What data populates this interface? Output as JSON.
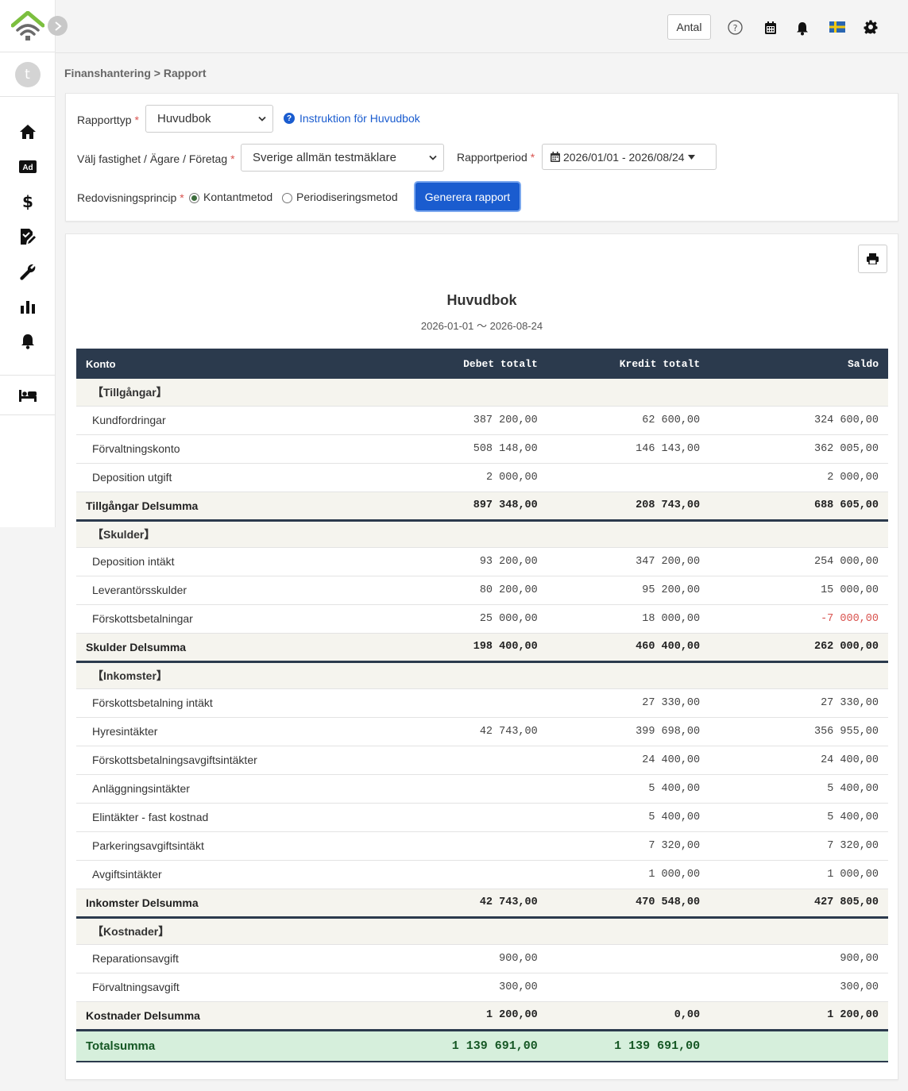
{
  "topbar": {
    "antal_label": "Antal"
  },
  "sidebar": {
    "avatar_letter": "t",
    "items": [
      {
        "icon": "home-icon"
      },
      {
        "icon": "ad-icon",
        "badge": "Ad"
      },
      {
        "icon": "dollar-icon",
        "glyph": "$"
      },
      {
        "icon": "document-edit-icon"
      },
      {
        "icon": "wrench-icon"
      },
      {
        "icon": "bar-chart-icon"
      },
      {
        "icon": "bell-icon"
      }
    ],
    "bottom_item": {
      "icon": "bed-icon"
    }
  },
  "breadcrumb": "Finanshantering > Rapport",
  "form": {
    "report_type_label": "Rapporttyp",
    "report_type_value": "Huvudbok",
    "help_link": "Instruktion för Huvudbok",
    "property_label": "Välj fastighet / Ägare / Företag",
    "property_value": "Sverige allmän testmäklare",
    "period_label": "Rapportperiod",
    "period_value": "2026/01/01 - 2026/08/24",
    "principle_label": "Redovisningsprincip",
    "radio_cash": "Kontantmetod",
    "radio_accrual": "Periodiseringsmetod",
    "selected_principle": "Kontantmetod",
    "generate_button": "Generera rapport"
  },
  "report": {
    "title": "Huvudbok",
    "subtitle": "2026-01-01 〜 2026-08-24",
    "columns": [
      "Konto",
      "Debet totalt",
      "Kredit totalt",
      "Saldo"
    ],
    "rows": [
      {
        "type": "section",
        "name": "【Tillgångar】"
      },
      {
        "type": "item",
        "name": "Kundfordringar",
        "debit": "387 200,00",
        "credit": "62 600,00",
        "balance": "324 600,00"
      },
      {
        "type": "item",
        "name": "Förvaltningskonto",
        "debit": "508 148,00",
        "credit": "146 143,00",
        "balance": "362 005,00"
      },
      {
        "type": "item",
        "name": "Deposition utgift",
        "debit": "2 000,00",
        "credit": "",
        "balance": "2 000,00"
      },
      {
        "type": "subtotal",
        "name": "Tillgångar Delsumma",
        "debit": "897 348,00",
        "credit": "208 743,00",
        "balance": "688 605,00"
      },
      {
        "type": "section",
        "name": "【Skulder】"
      },
      {
        "type": "item",
        "name": "Deposition intäkt",
        "debit": "93 200,00",
        "credit": "347 200,00",
        "balance": "254 000,00"
      },
      {
        "type": "item",
        "name": "Leverantörsskulder",
        "debit": "80 200,00",
        "credit": "95 200,00",
        "balance": "15 000,00"
      },
      {
        "type": "item",
        "name": "Förskottsbetalningar",
        "debit": "25 000,00",
        "credit": "18 000,00",
        "balance": "-7 000,00",
        "negative": true
      },
      {
        "type": "subtotal",
        "name": "Skulder Delsumma",
        "debit": "198 400,00",
        "credit": "460 400,00",
        "balance": "262 000,00"
      },
      {
        "type": "section",
        "name": "【Inkomster】"
      },
      {
        "type": "item",
        "name": "Förskottsbetalning intäkt",
        "debit": "",
        "credit": "27 330,00",
        "balance": "27 330,00"
      },
      {
        "type": "item",
        "name": "Hyresintäkter",
        "debit": "42 743,00",
        "credit": "399 698,00",
        "balance": "356 955,00"
      },
      {
        "type": "item",
        "name": "Förskottsbetalningsavgiftsintäkter",
        "debit": "",
        "credit": "24 400,00",
        "balance": "24 400,00"
      },
      {
        "type": "item",
        "name": "Anläggningsintäkter",
        "debit": "",
        "credit": "5 400,00",
        "balance": "5 400,00"
      },
      {
        "type": "item",
        "name": "Elintäkter - fast kostnad",
        "debit": "",
        "credit": "5 400,00",
        "balance": "5 400,00"
      },
      {
        "type": "item",
        "name": "Parkeringsavgiftsintäkt",
        "debit": "",
        "credit": "7 320,00",
        "balance": "7 320,00"
      },
      {
        "type": "item",
        "name": "Avgiftsintäkter",
        "debit": "",
        "credit": "1 000,00",
        "balance": "1 000,00"
      },
      {
        "type": "subtotal",
        "name": "Inkomster Delsumma",
        "debit": "42 743,00",
        "credit": "470 548,00",
        "balance": "427 805,00"
      },
      {
        "type": "section",
        "name": "【Kostnader】"
      },
      {
        "type": "item",
        "name": "Reparationsavgift",
        "debit": "900,00",
        "credit": "",
        "balance": "900,00"
      },
      {
        "type": "item",
        "name": "Förvaltningsavgift",
        "debit": "300,00",
        "credit": "",
        "balance": "300,00"
      },
      {
        "type": "subtotal",
        "name": "Kostnader Delsumma",
        "debit": "1 200,00",
        "credit": "0,00",
        "balance": "1 200,00"
      },
      {
        "type": "total",
        "name": "Totalsumma",
        "debit": "1 139 691,00",
        "credit": "1 139 691,00",
        "balance": ""
      }
    ]
  },
  "colors": {
    "header_dark": "#2b3a4d",
    "primary_blue": "#1a5ccf",
    "negative_red": "#d9534f",
    "total_green_bg": "#d6efdc",
    "section_bg": "#f5f4ee",
    "logo_green": "#7cbf3f"
  }
}
